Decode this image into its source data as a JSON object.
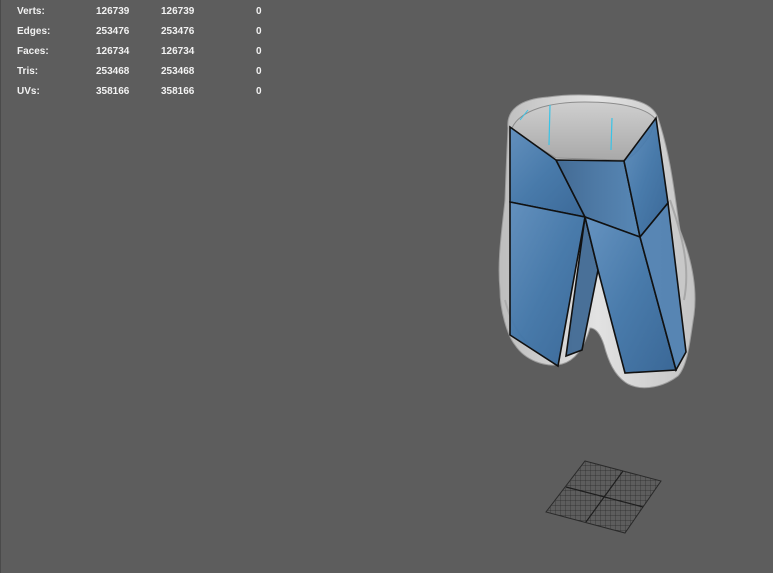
{
  "hud": {
    "rows": [
      {
        "label": "Verts:",
        "a": "126739",
        "b": "126739",
        "c": "0"
      },
      {
        "label": "Edges:",
        "a": "253476",
        "b": "253476",
        "c": "0"
      },
      {
        "label": "Faces:",
        "a": "126734",
        "b": "126734",
        "c": "0"
      },
      {
        "label": "Tris:",
        "a": "253468",
        "b": "253468",
        "c": "0"
      },
      {
        "label": "UVs:",
        "a": "358166",
        "b": "358166",
        "c": "0"
      }
    ]
  },
  "colors": {
    "viewport_background": "#5d5d5d",
    "hud_text": "#f2f2f2",
    "mesh_gray": "#d4d4d4",
    "uv_proxy_blue": "#3f74a6",
    "edge_black": "#111111",
    "highlight_cyan": "#39c3e6",
    "grid_dark": "#2a2a2a"
  }
}
